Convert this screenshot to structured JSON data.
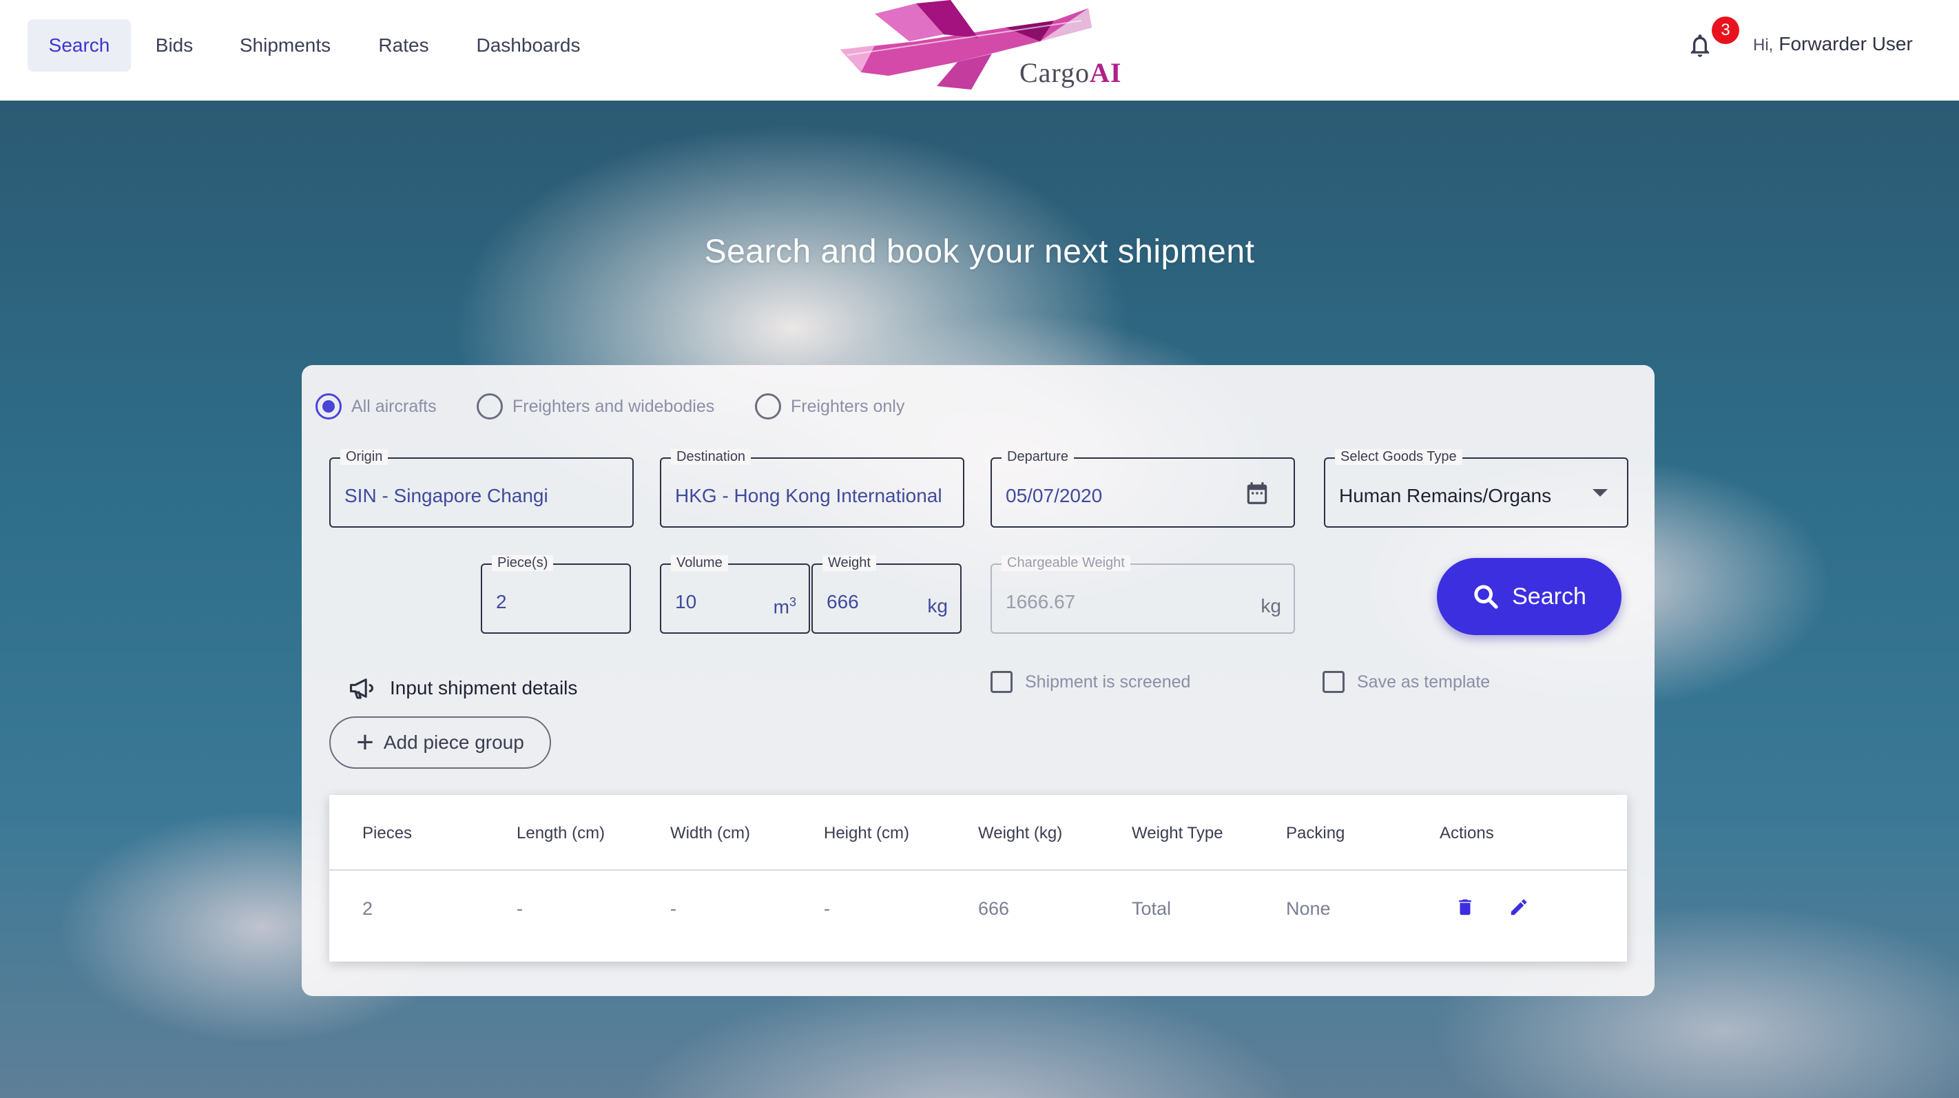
{
  "header": {
    "nav": [
      {
        "label": "Search",
        "active": true
      },
      {
        "label": "Bids"
      },
      {
        "label": "Shipments"
      },
      {
        "label": "Rates"
      },
      {
        "label": "Dashboards"
      }
    ],
    "logo": {
      "prefix": "Cargo",
      "suffix": "AI"
    },
    "notifications_count": "3",
    "greeting_prefix": "Hi,",
    "user_name": "Forwarder User"
  },
  "hero_title": "Search and book your next shipment",
  "aircraft_options": [
    {
      "label": "All aircrafts",
      "checked": true
    },
    {
      "label": "Freighters and widebodies",
      "checked": false
    },
    {
      "label": "Freighters only",
      "checked": false
    }
  ],
  "fields": {
    "origin": {
      "label": "Origin",
      "value": "SIN - Singapore Changi"
    },
    "destination": {
      "label": "Destination",
      "value": "HKG - Hong Kong International"
    },
    "departure": {
      "label": "Departure",
      "value": "05/07/2020"
    },
    "goods_type": {
      "label": "Select Goods Type",
      "value": "Human Remains/Organs"
    },
    "pieces": {
      "label": "Piece(s)",
      "value": "2"
    },
    "volume": {
      "label": "Volume",
      "value": "10",
      "unit": "m",
      "unit_sup": "3"
    },
    "weight": {
      "label": "Weight",
      "value": "666",
      "unit": "kg"
    },
    "chargeable_weight": {
      "label": "Chargeable Weight",
      "value": "1666.67",
      "unit": "kg"
    }
  },
  "search_button": "Search",
  "input_shipment_details": "Input shipment details",
  "checkboxes": {
    "screened": "Shipment is screened",
    "template": "Save as template"
  },
  "add_piece_group": "Add piece group",
  "table": {
    "headers": [
      "Pieces",
      "Length (cm)",
      "Width (cm)",
      "Height (cm)",
      "Weight (kg)",
      "Weight Type",
      "Packing",
      "Actions"
    ],
    "rows": [
      [
        "2",
        "-",
        "-",
        "-",
        "666",
        "Total",
        "None"
      ]
    ]
  },
  "colors": {
    "accent": "#3c2fe0",
    "nav_active": "#3d34d6",
    "badge": "#e8131d",
    "logo_magenta": "#b0208a"
  },
  "icons": [
    "bell-icon",
    "calendar-icon",
    "dropdown-caret-icon",
    "search-icon",
    "megaphone-icon",
    "plus-icon",
    "trash-icon",
    "pencil-icon"
  ]
}
